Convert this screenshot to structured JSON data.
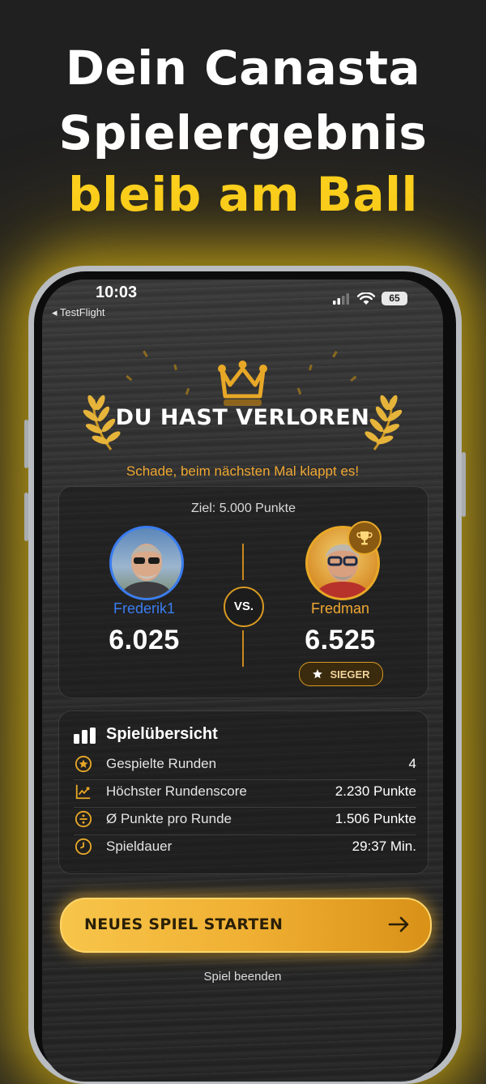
{
  "promo": {
    "line1": "Dein Canasta",
    "line2": "Spielergebnis",
    "line3": "bleib am Ball"
  },
  "status_bar": {
    "time": "10:03",
    "back_app": "◂ TestFlight",
    "battery": "65"
  },
  "result": {
    "title": "DU HAST VERLOREN",
    "subtitle": "Schade, beim nächsten Mal klappt es!"
  },
  "match": {
    "goal": "Ziel: 5.000 Punkte",
    "vs_label": "VS.",
    "player1": {
      "name": "Frederik1",
      "score": "6.025"
    },
    "player2": {
      "name": "Fredman",
      "score": "6.525",
      "badge": "SIEGER"
    }
  },
  "overview": {
    "title": "Spielübersicht",
    "rows": [
      {
        "icon": "star-circle-icon",
        "label": "Gespielte Runden",
        "value": "4"
      },
      {
        "icon": "trend-chart-icon",
        "label": "Höchster Rundenscore",
        "value": "2.230 Punkte"
      },
      {
        "icon": "divide-circle-icon",
        "label": "Ø Punkte pro Runde",
        "value": "1.506 Punkte"
      },
      {
        "icon": "clock-icon",
        "label": "Spieldauer",
        "value": "29:37 Min."
      }
    ]
  },
  "actions": {
    "new_game": "NEUES SPIEL STARTEN",
    "end_game": "Spiel beenden"
  },
  "colors": {
    "accent_gold": "#f0b033",
    "headline_yellow": "#ffd21f",
    "player1_blue": "#3b7df0",
    "player2_orange": "#f0a832"
  }
}
